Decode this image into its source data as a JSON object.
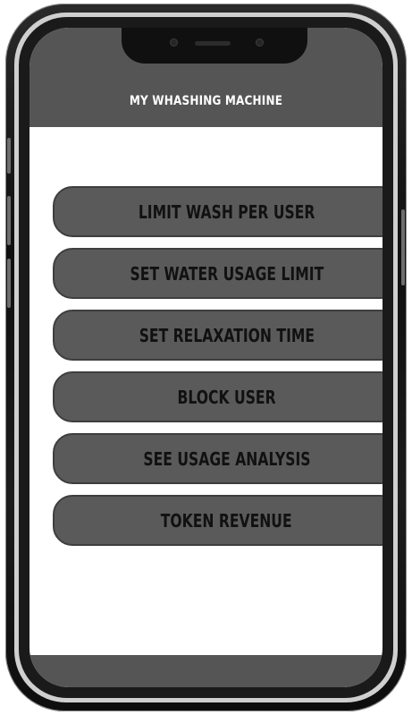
{
  "app": {
    "title": "MY WHASHING MACHINE"
  },
  "menu": {
    "items": [
      {
        "label": "LIMIT WASH PER USER"
      },
      {
        "label": "SET WATER USAGE LIMIT"
      },
      {
        "label": "SET RELAXATION TIME"
      },
      {
        "label": "BLOCK USER"
      },
      {
        "label": "SEE USAGE ANALYSIS"
      },
      {
        "label": "TOKEN REVENUE"
      }
    ]
  },
  "colors": {
    "header": "#555555",
    "button": "#5a5a5a",
    "screen": "#ffffff",
    "frame": "#111111"
  }
}
